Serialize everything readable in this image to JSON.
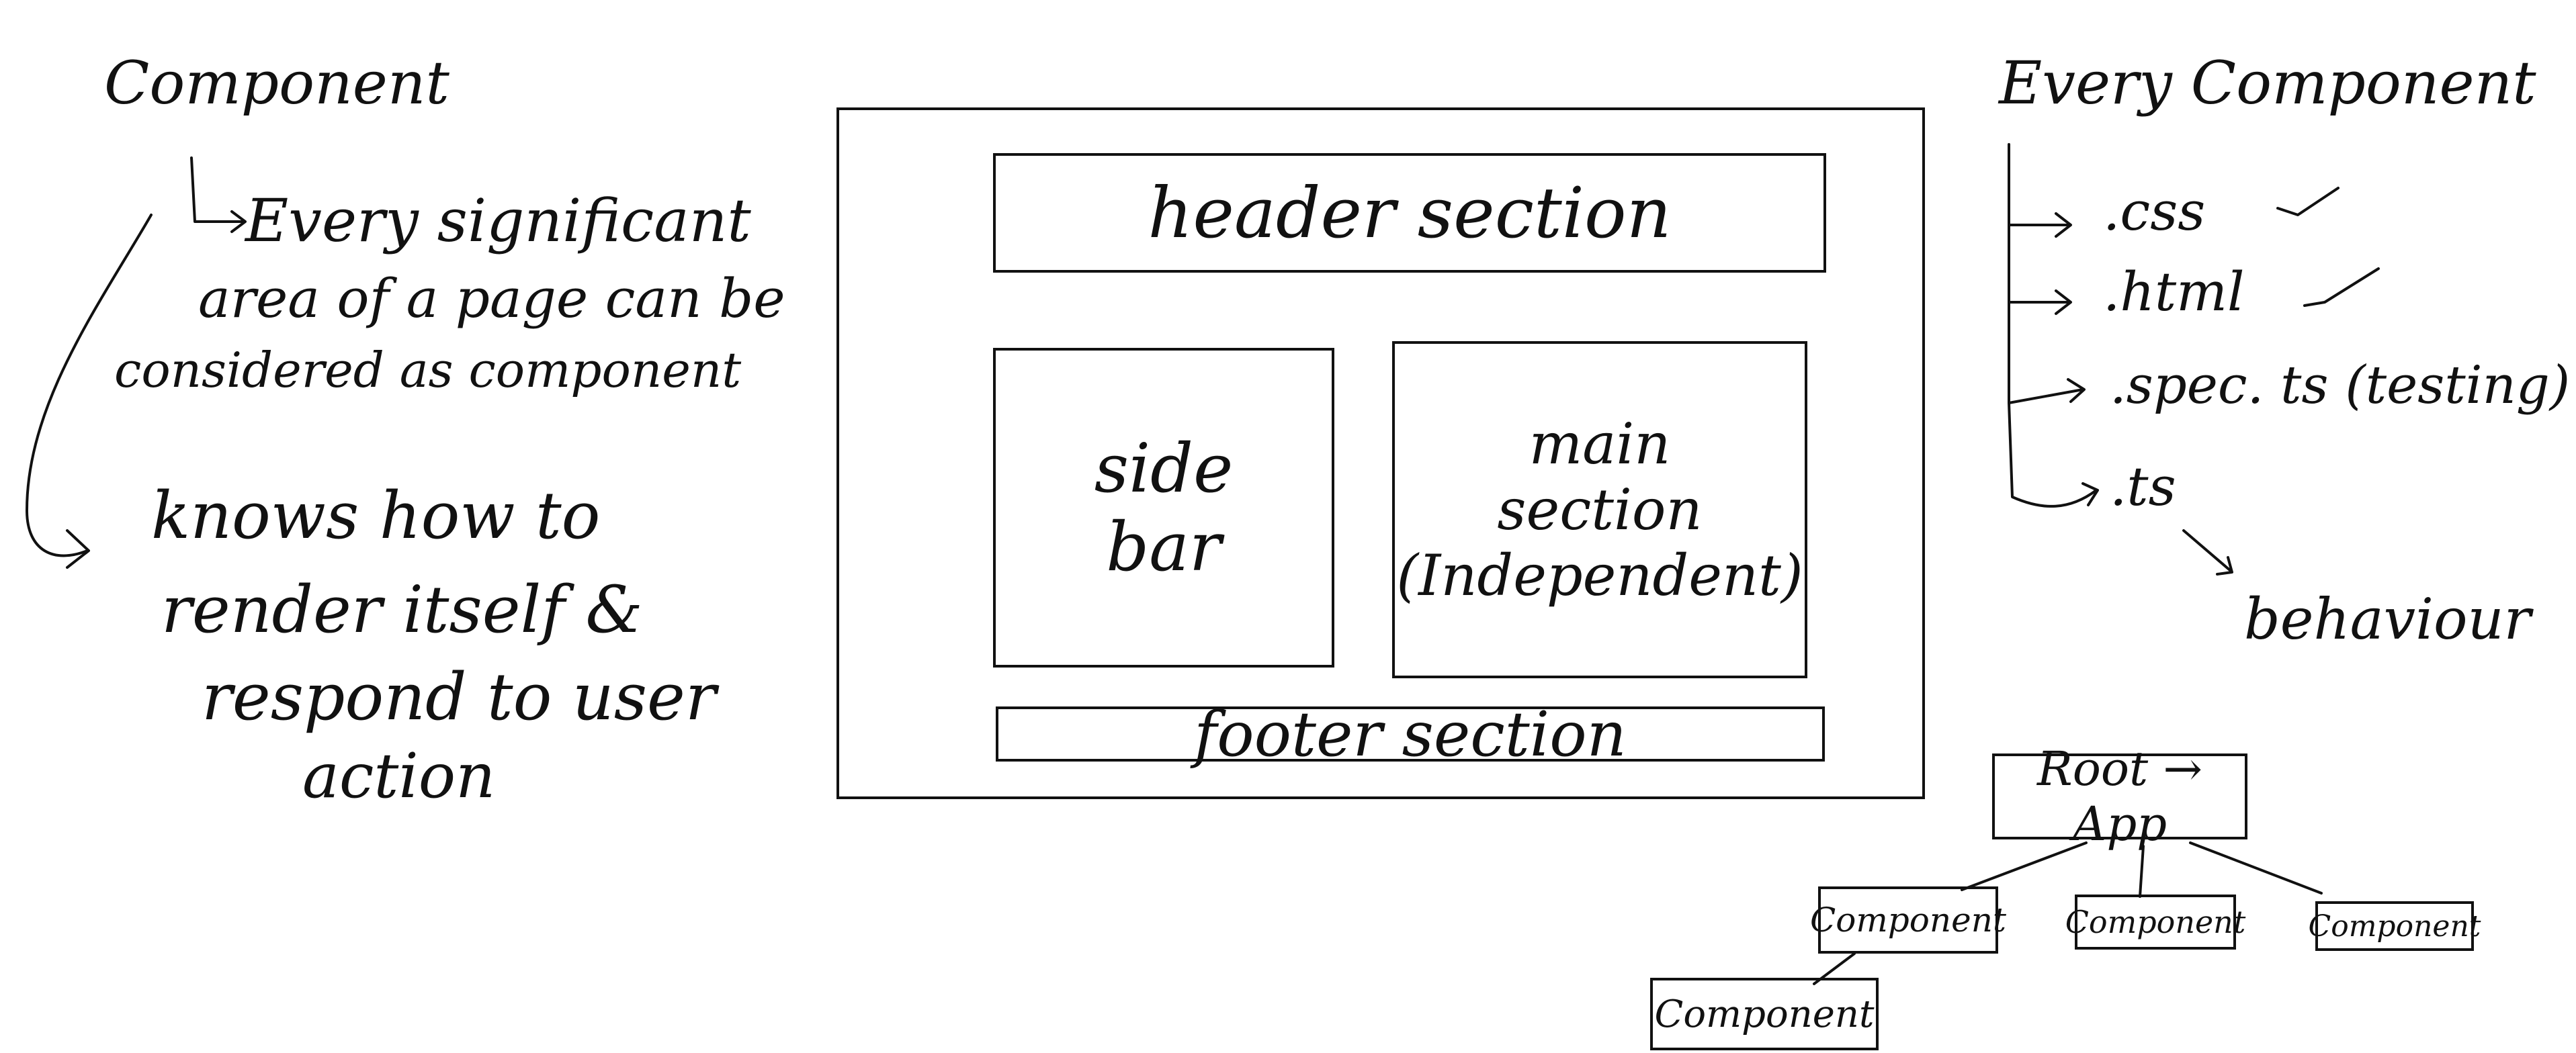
{
  "left_notes": {
    "title": "Component",
    "point1": [
      "Every significant",
      "area of a page can be",
      "considered as component"
    ],
    "point2": [
      "knows how to",
      "render itself &",
      "respond to user",
      "action"
    ]
  },
  "layout": {
    "header": "header section",
    "sidebar": [
      "side",
      "bar"
    ],
    "main": [
      "main",
      "section",
      "(Independent)"
    ],
    "footer": "footer section"
  },
  "right_notes": {
    "title": "Every Component",
    "items": [
      ".css",
      ".html",
      ".spec. ts (testing)",
      ".ts"
    ],
    "behaviour": "behaviour"
  },
  "tree": {
    "root": "Root → App",
    "children": [
      "Component",
      "Component",
      "Component"
    ],
    "grandchild": "Component"
  }
}
